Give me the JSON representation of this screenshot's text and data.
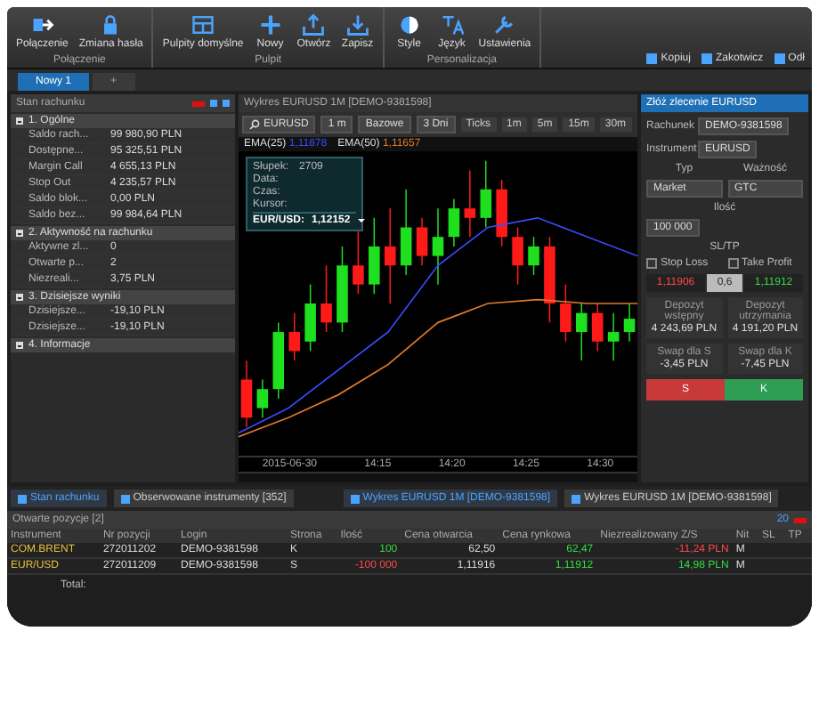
{
  "ribbon": {
    "groups": [
      {
        "label": "Połączenie",
        "buttons": [
          {
            "label": "Połączenie"
          },
          {
            "label": "Zmiana hasła"
          }
        ]
      },
      {
        "label": "Pulpit",
        "buttons": [
          {
            "label": "Pulpity domyślne"
          },
          {
            "label": "Nowy"
          },
          {
            "label": "Otwórz"
          },
          {
            "label": "Zapisz"
          }
        ]
      },
      {
        "label": "Personalizacja",
        "buttons": [
          {
            "label": "Style"
          },
          {
            "label": "Język"
          },
          {
            "label": "Ustawienia"
          }
        ]
      }
    ],
    "quick_actions": [
      "Kopiuj",
      "Zakotwicz",
      "Odł"
    ]
  },
  "workspace_tabs": [
    {
      "label": "Nowy 1",
      "selected": true
    },
    {
      "label": "+",
      "selected": false
    }
  ],
  "account_panel": {
    "title": "Stan rachunku",
    "sections": [
      {
        "title": "1. Ogólne",
        "expanded": true,
        "rows": [
          {
            "label": "Saldo rach...",
            "value": "99 980,90 PLN"
          },
          {
            "label": "Dostępne...",
            "value": "95 325,51 PLN"
          },
          {
            "label": "Margin Call",
            "value": "4 655,13 PLN"
          },
          {
            "label": "Stop Out",
            "value": "4 235,57 PLN"
          },
          {
            "label": "Saldo blok...",
            "value": "0,00 PLN"
          },
          {
            "label": "Saldo bez...",
            "value": "99 984,64 PLN"
          }
        ]
      },
      {
        "title": "2. Aktywność na rachunku",
        "expanded": true,
        "rows": [
          {
            "label": "Aktywne zl...",
            "value": "0"
          },
          {
            "label": "Otwarte p...",
            "value": "2"
          },
          {
            "label": "Niezreali...",
            "value": "3,75 PLN"
          }
        ]
      },
      {
        "title": "3. Dzisiejsze wyniki",
        "expanded": true,
        "rows": [
          {
            "label": "Dzisiejsze...",
            "value": "-19,10 PLN"
          },
          {
            "label": "Dzisiejsze...",
            "value": "-19,10 PLN"
          }
        ]
      },
      {
        "title": "4. Informacje",
        "expanded": true
      }
    ]
  },
  "chart": {
    "title": "Wykres EURUSD 1M [DEMO-9381598]",
    "symbol": "EURUSD",
    "interval": "1 m",
    "style": "Bazowe",
    "range": "3 Dni",
    "timeframes": [
      "Ticks",
      "1m",
      "5m",
      "15m",
      "30m"
    ],
    "indicators": [
      {
        "label": "EMA(25)",
        "value": "1,11878",
        "color": "#3a4bff"
      },
      {
        "label": "EMA(50)",
        "value": "1,11657",
        "color": "#e07b2a"
      }
    ],
    "tooltip": {
      "rows": [
        {
          "label": "Słupek:",
          "value": "2709"
        },
        {
          "label": "Data:",
          "value": ""
        },
        {
          "label": "Czas:",
          "value": ""
        },
        {
          "label": "Kursor:",
          "value": ""
        }
      ],
      "symbol": "EUR/USD:",
      "price": "1,12152"
    },
    "x_labels": [
      "2015-06-30",
      "14:15",
      "14:20",
      "14:25",
      "14:30"
    ]
  },
  "order_panel": {
    "title": "Złóż zlecenie EURUSD",
    "account_label": "Rachunek",
    "account": "DEMO-9381598",
    "instrument_label": "Instrument",
    "instrument": "EURUSD",
    "type_label": "Typ",
    "type": "Market",
    "validity_label": "Ważność",
    "validity": "GTC",
    "quantity_label": "Ilość",
    "quantity": "100 000",
    "sltp_label": "SL/TP",
    "options": [
      {
        "label": "Stop Loss",
        "checked": false
      },
      {
        "label": "Take Profit",
        "checked": false
      }
    ],
    "sell_price": "1,11906",
    "spread": "0,6",
    "buy_price": "1,11912",
    "stats": [
      {
        "label": "Depozyt wstępny",
        "value": "4 243,69 PLN"
      },
      {
        "label": "Depozyt utrzymania",
        "value": "4 191,20 PLN"
      },
      {
        "label": "Swap dla S",
        "value": "-3,45 PLN"
      },
      {
        "label": "Swap dla K",
        "value": "-7,45 PLN"
      }
    ],
    "sell_button": "S",
    "buy_button": "K"
  },
  "bottom_tabs": {
    "side": [
      {
        "label": "Stan rachunku",
        "selected": true
      },
      {
        "label": "Obserwowane instrumenty [352]",
        "selected": false
      }
    ],
    "center": [
      {
        "label": "Wykres EURUSD 1M [DEMO-9381598]",
        "selected": true
      },
      {
        "label": "Wykres EURUSD 1M [DEMO-9381598]",
        "selected": false
      }
    ]
  },
  "positions": {
    "title": "Otwarte pozycje [2]",
    "count": "20",
    "columns": [
      "Instrument",
      "Nr pozycji",
      "Login",
      "Strona",
      "Ilość",
      "Cena otwarcia",
      "Cena rynkowa",
      "Niezrealizowany Z/S",
      "Nit",
      "SL",
      "TP"
    ],
    "rows": [
      {
        "instrument": "COM.BRENT",
        "number": "272011202",
        "login": "DEMO-9381598",
        "side": "K",
        "quantity": {
          "text": "100",
          "color": "#33dd44"
        },
        "open_price": "62,50",
        "market_price": {
          "text": "62,47",
          "color": "#33dd44"
        },
        "pl": {
          "text": "-11,24 PLN",
          "color": "#ff4a4a"
        },
        "nit": "M"
      },
      {
        "instrument": "EUR/USD",
        "number": "272011209",
        "login": "DEMO-9381598",
        "side": "S",
        "quantity": {
          "text": "-100 000",
          "color": "#ff4a4a"
        },
        "open_price": "1,11916",
        "market_price": {
          "text": "1,11912",
          "color": "#33dd44"
        },
        "pl": {
          "text": "14,98 PLN",
          "color": "#33dd44"
        },
        "nit": "M"
      }
    ],
    "total_label": "Total:"
  }
}
